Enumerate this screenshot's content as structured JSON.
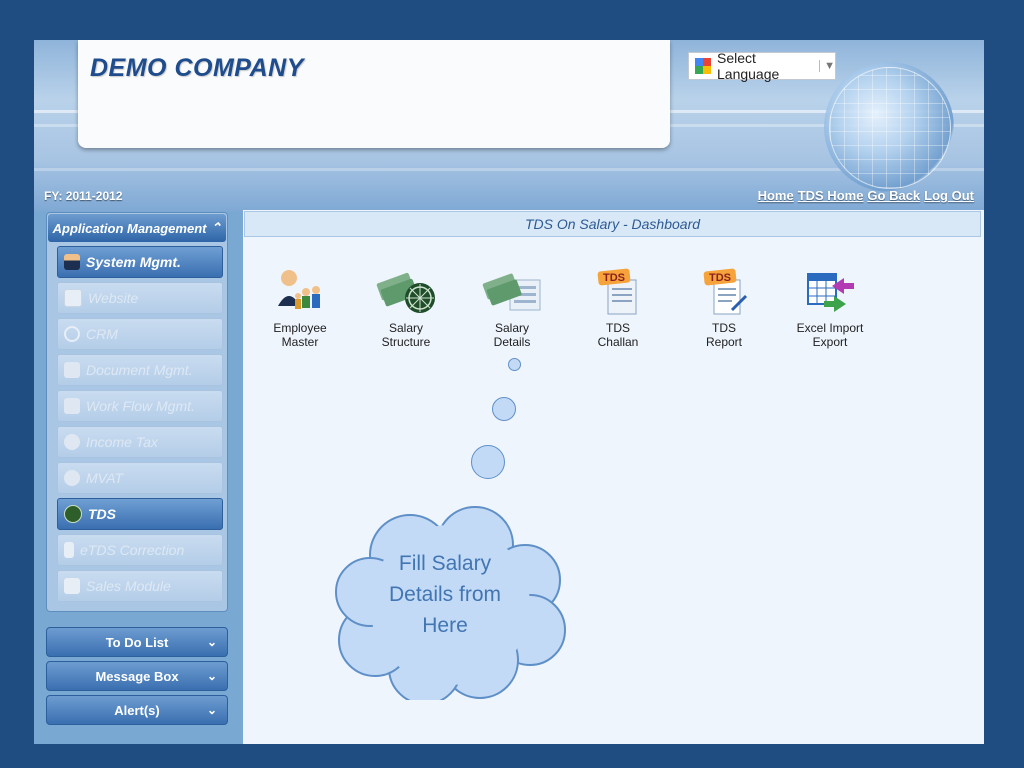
{
  "header": {
    "company_name": "DEMO COMPANY",
    "language_label": "Select Language",
    "language_arrow": "▼",
    "fy_label": "FY: 2011-2012",
    "links": [
      "Home",
      "TDS Home",
      "Go Back",
      "Log Out"
    ]
  },
  "sidebar": {
    "section_title": "Application Management",
    "items": [
      {
        "label": "System Mgmt.",
        "active": true,
        "icon": "user-icon"
      },
      {
        "label": "Website",
        "active": false,
        "icon": "chart-icon"
      },
      {
        "label": "CRM",
        "active": false,
        "icon": "gear-icon"
      },
      {
        "label": "Document Mgmt.",
        "active": false,
        "icon": "document-search-icon"
      },
      {
        "label": "Work Flow Mgmt.",
        "active": false,
        "icon": "workflow-icon"
      },
      {
        "label": "Income Tax",
        "active": false,
        "icon": "tax-icon"
      },
      {
        "label": "MVAT",
        "active": false,
        "icon": "vat-icon"
      },
      {
        "label": "TDS",
        "active": true,
        "icon": "tds-icon"
      },
      {
        "label": "eTDS Correction",
        "active": false,
        "icon": "file-icon"
      },
      {
        "label": "Sales Module",
        "active": false,
        "icon": "sales-chart-icon"
      }
    ],
    "panels": [
      "To Do List",
      "Message Box",
      "Alert(s)"
    ]
  },
  "main": {
    "title": "TDS On Salary - Dashboard",
    "items": [
      {
        "label_line1": "Employee",
        "label_line2": "Master",
        "icon": "employee-group-icon"
      },
      {
        "label_line1": "Salary",
        "label_line2": "Structure",
        "icon": "money-stack-icon"
      },
      {
        "label_line1": "Salary",
        "label_line2": "Details",
        "icon": "money-details-icon"
      },
      {
        "label_line1": "TDS",
        "label_line2": "Challan",
        "icon": "tds-challan-icon"
      },
      {
        "label_line1": "TDS",
        "label_line2": "Report",
        "icon": "tds-report-icon"
      },
      {
        "label_line1": "Excel Import",
        "label_line2": "Export",
        "icon": "excel-import-export-icon"
      }
    ]
  },
  "callout": {
    "line1": "Fill Salary",
    "line2": "Details from",
    "line3": "Here"
  },
  "colors": {
    "background": "#1f4d82",
    "accent_blue": "#3a6fb0",
    "cloud_fill": "#c3daf7",
    "cloud_text": "#4276b3"
  }
}
